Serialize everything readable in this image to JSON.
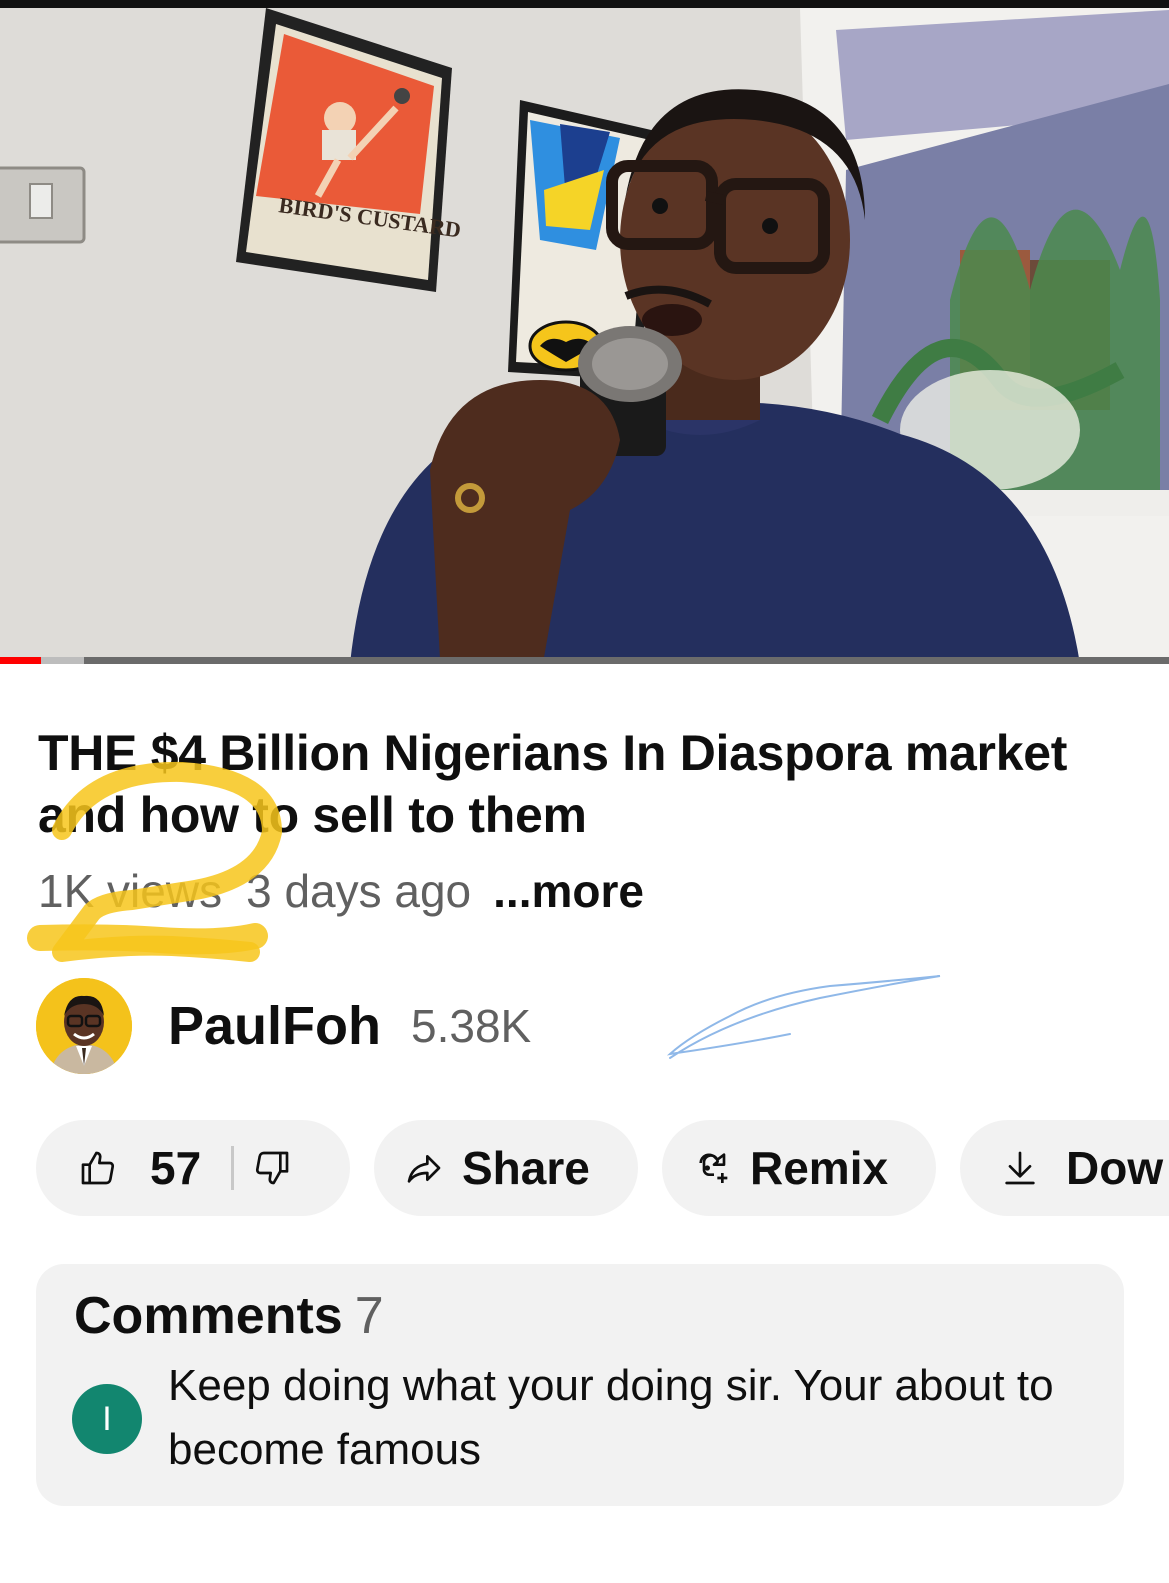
{
  "video": {
    "poster_text": "BIRD'S CUSTARD",
    "progress_fraction": 0.035,
    "progress_color": "#ff0000"
  },
  "title": "THE $4 Billion Nigerians In Diaspora market and how to sell to them",
  "meta": {
    "views": "1K views",
    "age": "3 days ago",
    "more_label": "...more"
  },
  "channel": {
    "name": "PaulFoh",
    "subscribers": "5.38K",
    "avatar_icon": "channel-avatar-photo"
  },
  "actions": {
    "like_count": "57",
    "share_label": "Share",
    "remix_label": "Remix",
    "download_label": "Dow"
  },
  "comments": {
    "title": "Comments",
    "count": "7",
    "top_comment": {
      "avatar_initial": "I",
      "avatar_color": "#12866f",
      "text": "Keep doing what your doing sir. Your about to become famous"
    }
  },
  "colors": {
    "annotation_yellow": "#f7c51b",
    "annotation_blue": "#8fb8e8"
  }
}
